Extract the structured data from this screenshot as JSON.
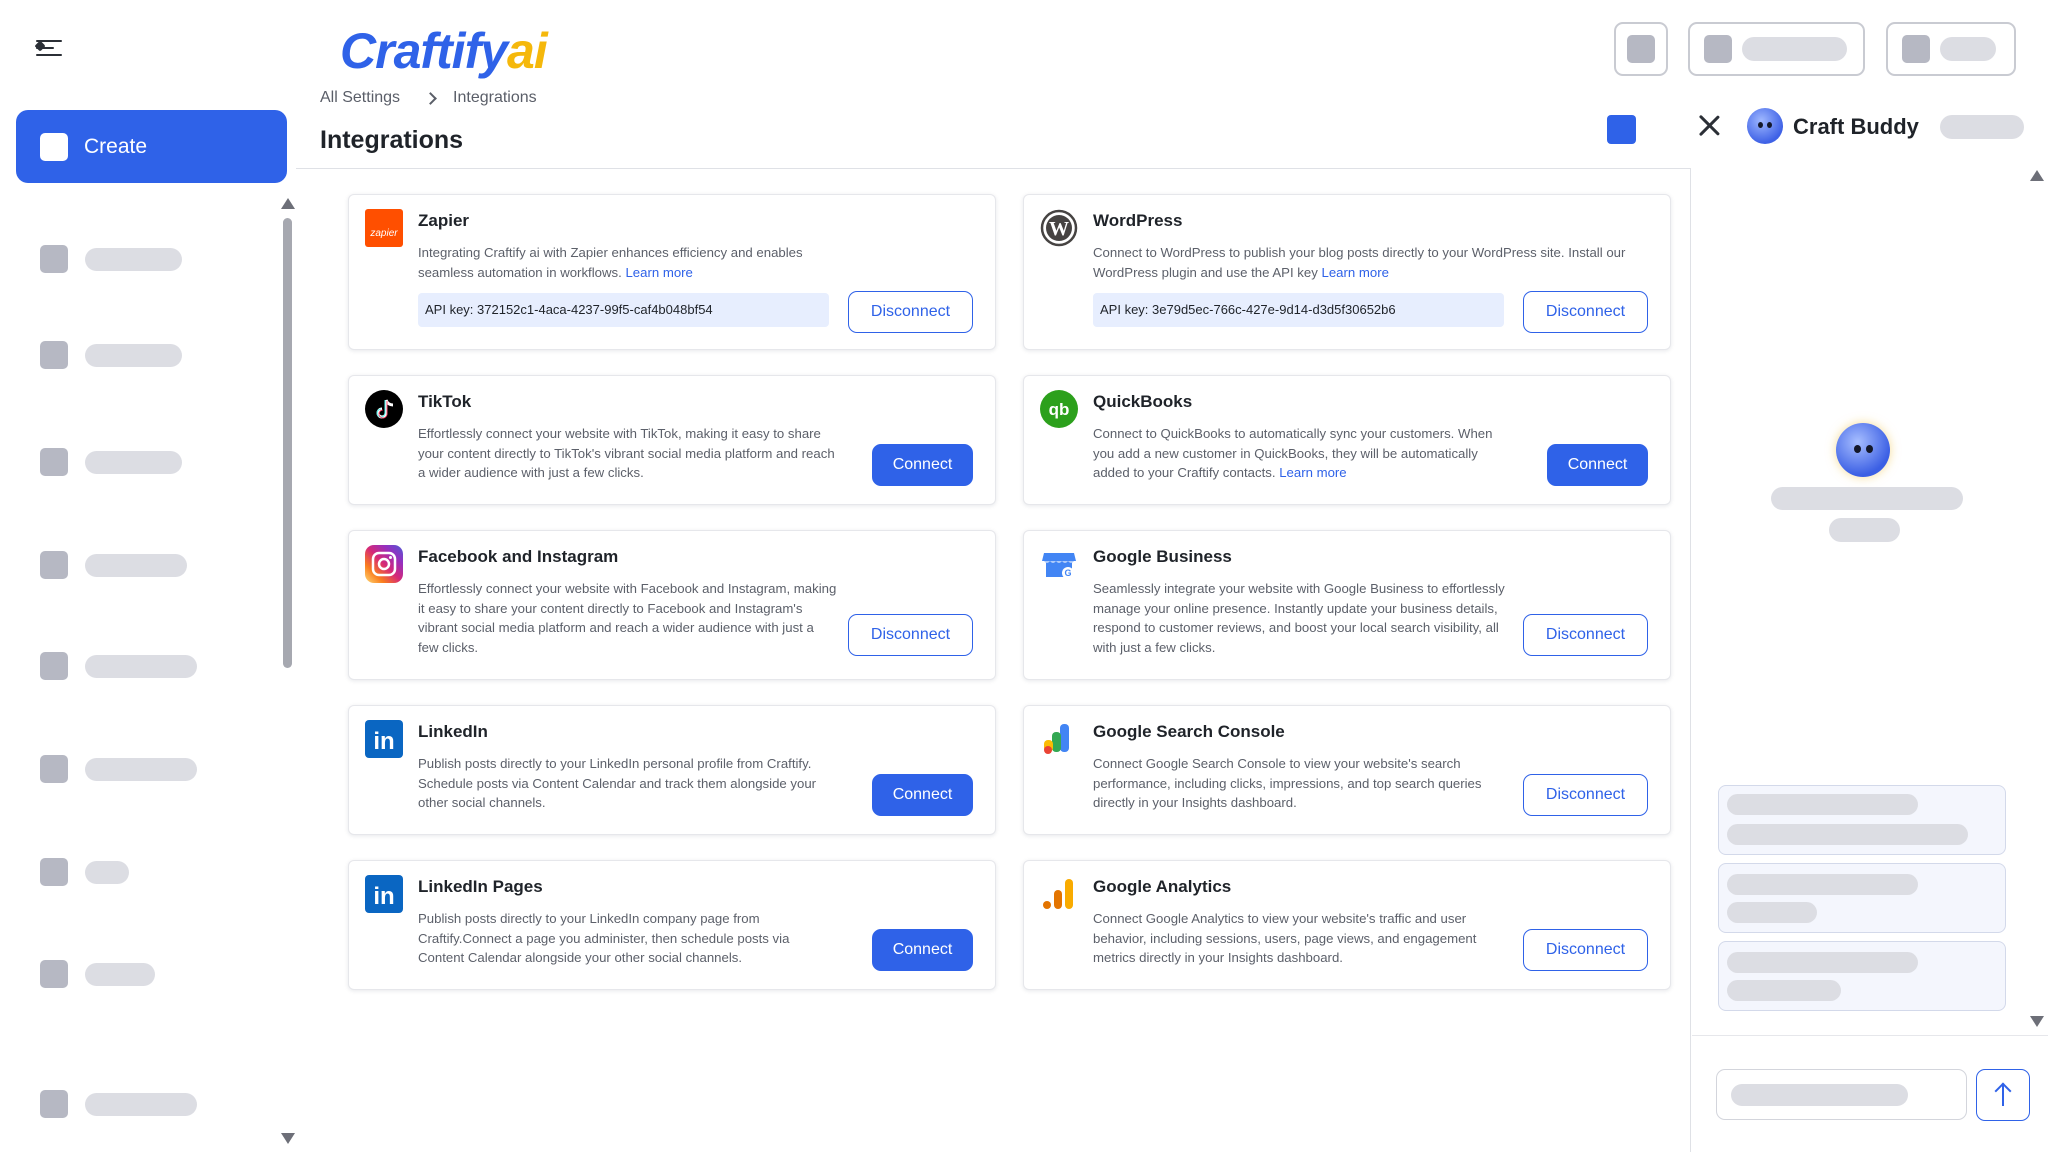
{
  "app": {
    "logo_main": "Craftify",
    "logo_ai": "ai"
  },
  "sidebar": {
    "create_label": "Create"
  },
  "breadcrumb": {
    "root": "All Settings",
    "current": "Integrations"
  },
  "page": {
    "title": "Integrations"
  },
  "chat": {
    "name": "Craft Buddy"
  },
  "colors": {
    "accent": "#2f62e8",
    "accent_light": "#e7eefe",
    "logo_ai": "#f5b80b"
  },
  "cards": [
    {
      "title": "Zapier",
      "icon": "zapier-icon",
      "desc": "Integrating Craftify ai with Zapier enhances efficiency and enables seamless automation in workflows.",
      "learn": "Learn more",
      "api_key": "API key: 372152c1-4aca-4237-99f5-caf4b048bf54",
      "button": "Disconnect"
    },
    {
      "title": "WordPress",
      "icon": "wordpress-icon",
      "desc": "Connect to WordPress to publish your blog posts directly to your WordPress site. Install our WordPress plugin and use the API key",
      "learn": "Learn more",
      "api_key": "API key: 3e79d5ec-766c-427e-9d14-d3d5f30652b6",
      "button": "Disconnect"
    },
    {
      "title": "TikTok",
      "icon": "tiktok-icon",
      "desc": "Effortlessly connect your website with TikTok, making it easy to share your content directly to TikTok's vibrant social media platform and reach a wider audience with just a few clicks.",
      "button": "Connect"
    },
    {
      "title": "QuickBooks",
      "icon": "quickbooks-icon",
      "desc": "Connect to QuickBooks to automatically sync your customers. When you add a new customer in QuickBooks, they will be automatically added to your Craftify contacts.",
      "learn": "Learn more",
      "button": "Connect"
    },
    {
      "title": "Facebook and Instagram",
      "icon": "instagram-icon",
      "desc": "Effortlessly connect your website with Facebook and Instagram, making it easy to share your content directly to Facebook and Instagram's vibrant social media platform and reach a wider audience with just a few clicks.",
      "button": "Disconnect"
    },
    {
      "title": "Google Business",
      "icon": "google-business-icon",
      "desc": "Seamlessly integrate your website with Google Business to effortlessly manage your online presence. Instantly update your business details, respond to customer reviews, and boost your local search visibility, all with just a few clicks.",
      "button": "Disconnect"
    },
    {
      "title": "LinkedIn",
      "icon": "linkedin-icon",
      "desc": "Publish posts directly to your LinkedIn personal profile from Craftify. Schedule posts via Content Calendar and track them alongside your other social channels.",
      "button": "Connect"
    },
    {
      "title": "Google Search Console",
      "icon": "google-search-console-icon",
      "desc": "Connect Google Search Console to view your website's search performance, including clicks, impressions, and top search queries directly in your Insights dashboard.",
      "button": "Disconnect"
    },
    {
      "title": "LinkedIn Pages",
      "icon": "linkedin-pages-icon",
      "desc": "Publish posts directly to your LinkedIn company page from Craftify.Connect a page you administer, then schedule posts via Content Calendar alongside your other social channels.",
      "button": "Connect"
    },
    {
      "title": "Google Analytics",
      "icon": "google-analytics-icon",
      "desc": "Connect Google Analytics to view your website's traffic and user behavior, including sessions, users, page views, and engagement metrics directly in your Insights dashboard.",
      "button": "Disconnect"
    }
  ]
}
